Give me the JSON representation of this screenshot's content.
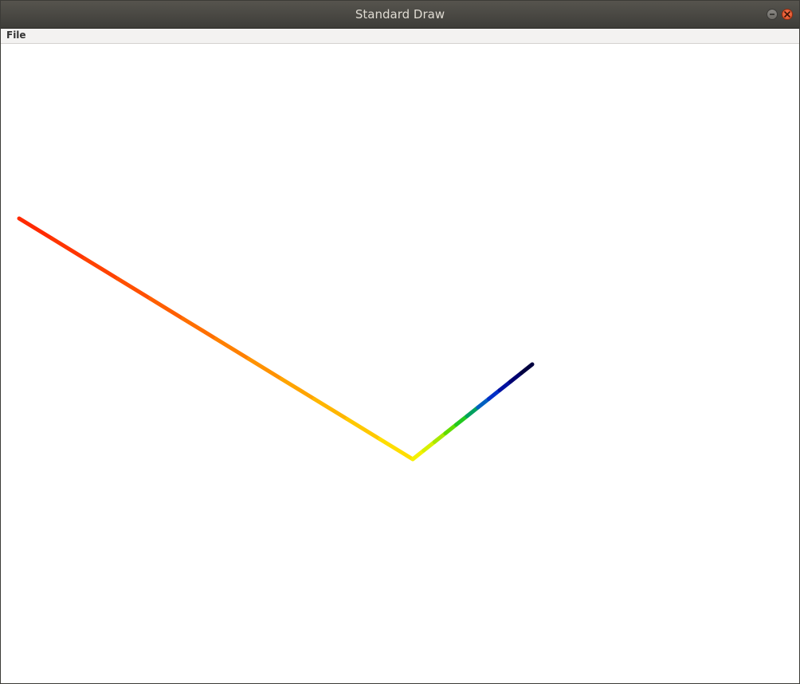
{
  "window": {
    "title": "Standard Draw"
  },
  "menu": {
    "file_label": "File"
  },
  "controls": {
    "minimize_icon": "minimize-icon",
    "close_icon": "close-icon"
  },
  "drawing": {
    "segment_colors": [
      "#ff2a00",
      "#ff3500",
      "#ff4200",
      "#ff5000",
      "#ff5f00",
      "#ff6f00",
      "#ff8000",
      "#ff9200",
      "#ffa400",
      "#ffb600",
      "#ffc800",
      "#ffdd00",
      "#f5f000",
      "#d8f000",
      "#a8e800",
      "#60dd00",
      "#22c820",
      "#00a060",
      "#0060c0",
      "#0030c8",
      "#0010a0",
      "#000070",
      "#000040"
    ]
  }
}
